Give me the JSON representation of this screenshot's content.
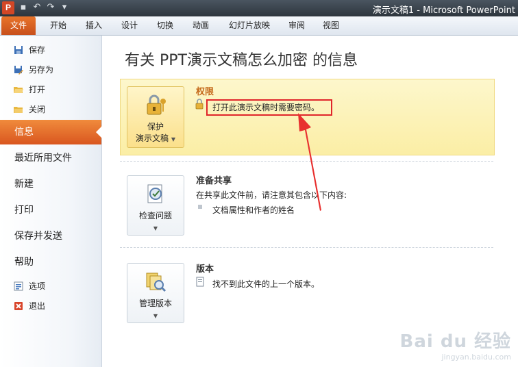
{
  "titlebar": {
    "app_letter": "P",
    "title": "演示文稿1 - Microsoft PowerPoint"
  },
  "ribbon": {
    "tabs": [
      {
        "label": "文件"
      },
      {
        "label": "开始"
      },
      {
        "label": "插入"
      },
      {
        "label": "设计"
      },
      {
        "label": "切换"
      },
      {
        "label": "动画"
      },
      {
        "label": "幻灯片放映"
      },
      {
        "label": "审阅"
      },
      {
        "label": "视图"
      }
    ]
  },
  "nav": {
    "small_top": [
      {
        "label": "保存",
        "icon": "save-icon"
      },
      {
        "label": "另存为",
        "icon": "save-as-icon"
      },
      {
        "label": "打开",
        "icon": "open-folder-icon"
      },
      {
        "label": "关闭",
        "icon": "close-folder-icon"
      }
    ],
    "big": [
      {
        "label": "信息"
      },
      {
        "label": "最近所用文件"
      },
      {
        "label": "新建"
      },
      {
        "label": "打印"
      },
      {
        "label": "保存并发送"
      },
      {
        "label": "帮助"
      }
    ],
    "small_bottom": [
      {
        "label": "选项",
        "icon": "options-icon"
      },
      {
        "label": "退出",
        "icon": "exit-icon"
      }
    ],
    "active": "信息"
  },
  "main": {
    "page_title": "有关 PPT演示文稿怎么加密 的信息",
    "permissions": {
      "button_line1": "保护",
      "button_line2": "演示文稿",
      "title": "权限",
      "message": "打开此演示文稿时需要密码。"
    },
    "prepare": {
      "button_label": "检查问题",
      "title": "准备共享",
      "description": "在共享此文件前，请注意其包含以下内容:",
      "bullet": "文档属性和作者的姓名"
    },
    "versions": {
      "button_label": "管理版本",
      "title": "版本",
      "message": "找不到此文件的上一个版本。"
    }
  },
  "watermark": {
    "line1": "Bai du 经验",
    "line2": "jingyan.baidu.com"
  },
  "colors": {
    "file_tab": "#d9561f",
    "active_nav": "#e66f2c",
    "permissions_bg": "#fcf2b8",
    "highlight_red": "#e0252a"
  }
}
